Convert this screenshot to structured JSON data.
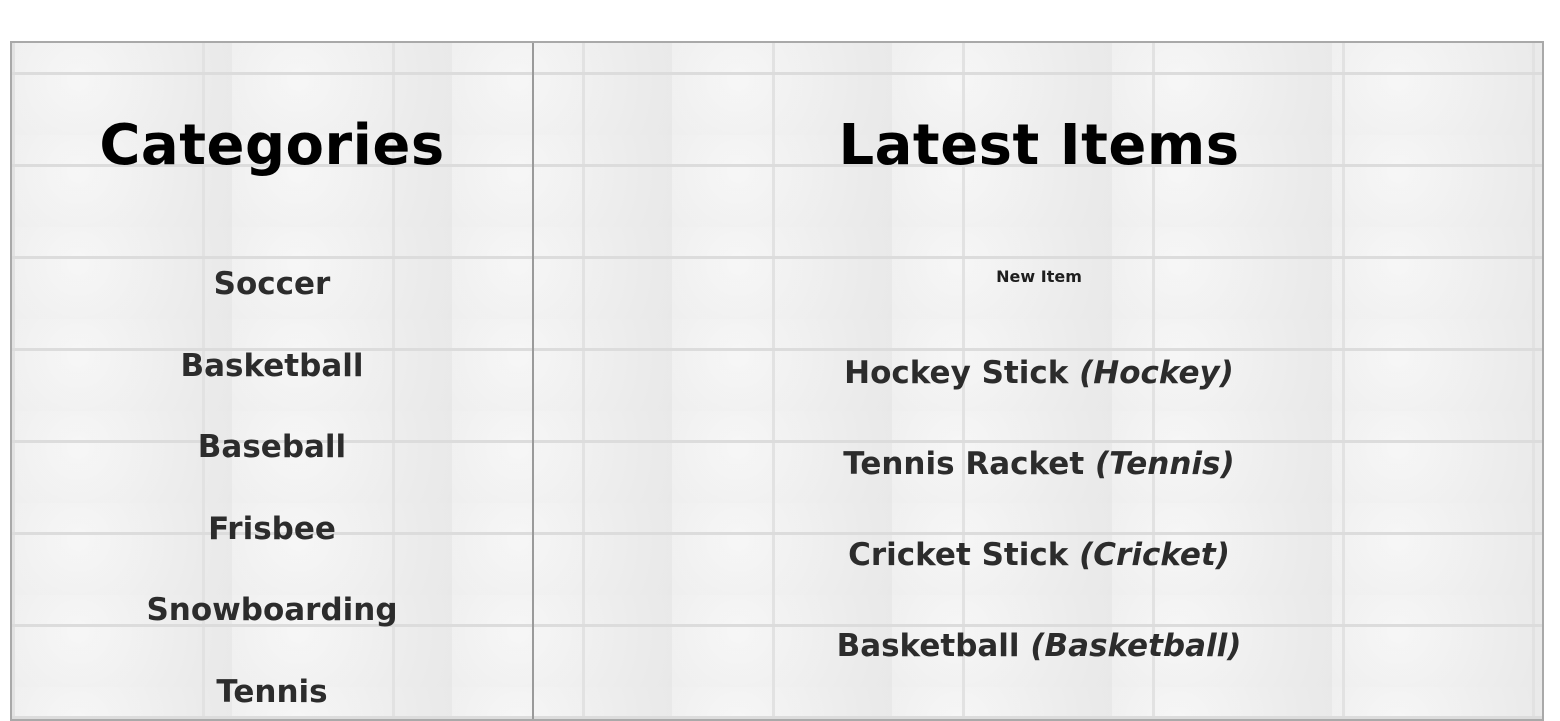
{
  "categories": {
    "title": "Categories",
    "items": [
      "Soccer",
      "Basketball",
      "Baseball",
      "Frisbee",
      "Snowboarding",
      "Tennis"
    ]
  },
  "latest": {
    "title": "Latest Items",
    "new_item_label": "New Item",
    "items": [
      {
        "name": "Hockey Stick",
        "category": "(Hockey)"
      },
      {
        "name": "Tennis Racket",
        "category": "(Tennis)"
      },
      {
        "name": "Cricket Stick",
        "category": "(Cricket)"
      },
      {
        "name": "Basketball",
        "category": "(Basketball)"
      }
    ]
  }
}
